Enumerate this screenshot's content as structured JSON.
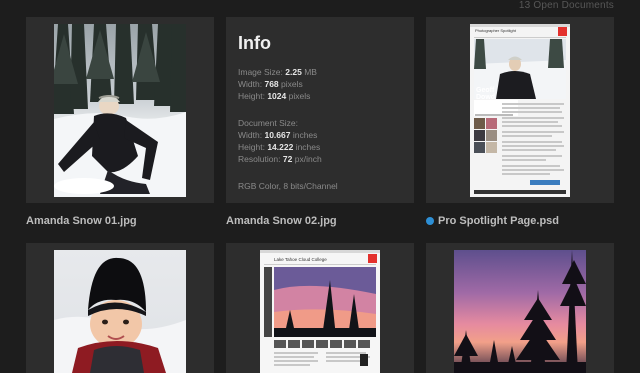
{
  "header": {
    "open_count_label": "13 Open Documents"
  },
  "documents": [
    {
      "name": "Amanda Snow 01.jpg",
      "unsaved": false
    },
    {
      "name": "Amanda Snow 02.jpg",
      "unsaved": false
    },
    {
      "name": "Pro Spotlight Page.psd",
      "unsaved": true
    }
  ],
  "info": {
    "title": "Info",
    "image_size_label": "Image Size:",
    "image_size_value": "2.25",
    "image_size_unit": "MB",
    "width_label": "Width:",
    "width_value": "768",
    "width_unit": "pixels",
    "height_label": "Height:",
    "height_value": "1024",
    "height_unit": "pixels",
    "doc_size_label": "Document Size:",
    "doc_width_label": "Width:",
    "doc_width_value": "10.667",
    "doc_width_unit": "inches",
    "doc_height_label": "Height:",
    "doc_height_value": "14.222",
    "doc_height_unit": "inches",
    "resolution_label": "Resolution:",
    "resolution_value": "72",
    "resolution_unit": "px/inch",
    "color_mode": "RGB Color, 8 bits/Channel"
  },
  "spotlight_page": {
    "heading": "Photographer Spotlight",
    "name_line1": "Geoff",
    "name_line2": "Dowd"
  },
  "college_page": {
    "heading": "Lake Tahoe Cloud College"
  },
  "colors": {
    "background": "#1d1d1d",
    "card": "#2d2d2d",
    "unsaved_dot": "#2d8fd5",
    "adobe_red": "#e3312d"
  }
}
